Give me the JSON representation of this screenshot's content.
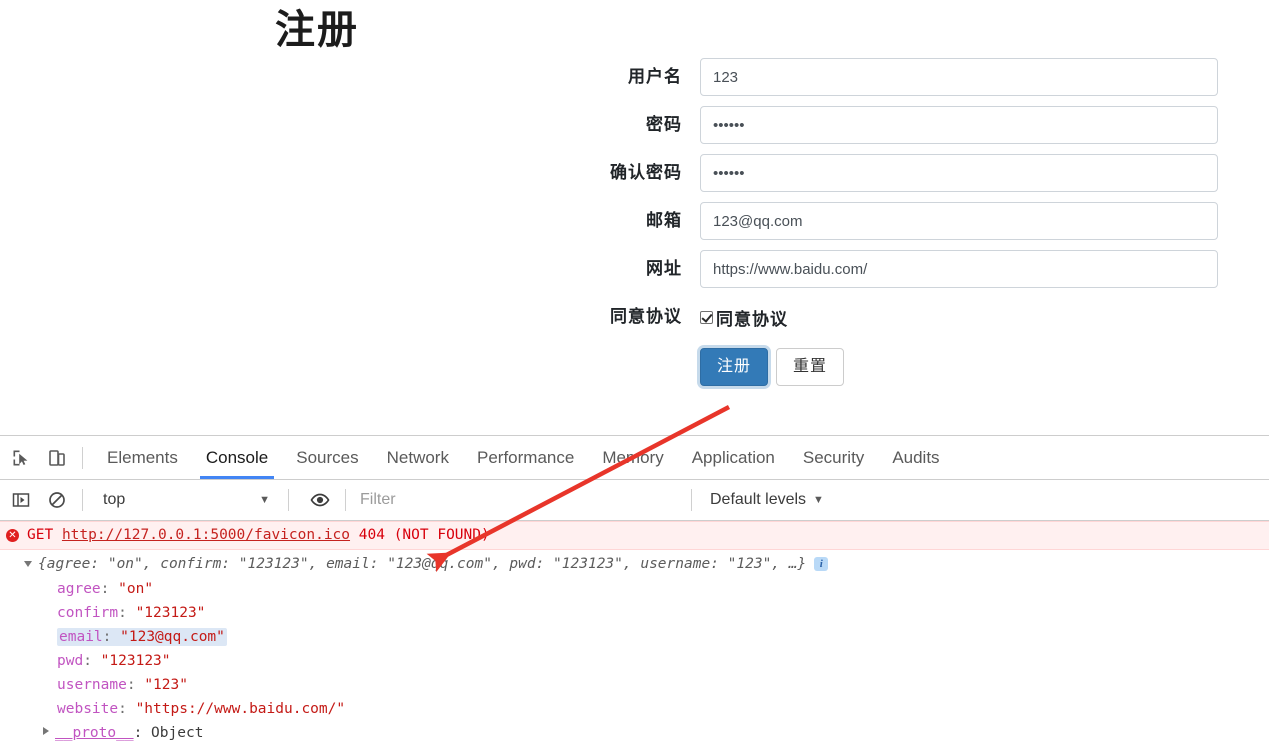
{
  "page": {
    "title": "注册",
    "form": {
      "fields": [
        {
          "label": "用户名",
          "value": "123",
          "type": "text",
          "name": "username"
        },
        {
          "label": "密码",
          "value": "123123",
          "type": "password",
          "name": "pwd"
        },
        {
          "label": "确认密码",
          "value": "123123",
          "type": "password",
          "name": "confirm"
        },
        {
          "label": "邮箱",
          "value": "123@qq.com",
          "type": "email",
          "name": "email"
        },
        {
          "label": "网址",
          "value": "https://www.baidu.com/",
          "type": "url",
          "name": "website"
        }
      ],
      "agree": {
        "label": "同意协议",
        "checkbox_label": "同意协议",
        "checked": true
      },
      "buttons": {
        "submit": "注册",
        "reset": "重置"
      }
    }
  },
  "devtools": {
    "toolbar_icons": [
      {
        "name": "inspect-element-icon"
      },
      {
        "name": "device-toolbar-icon"
      }
    ],
    "tabs": [
      {
        "label": "Elements",
        "active": false
      },
      {
        "label": "Console",
        "active": true
      },
      {
        "label": "Sources",
        "active": false
      },
      {
        "label": "Network",
        "active": false
      },
      {
        "label": "Performance",
        "active": false
      },
      {
        "label": "Memory",
        "active": false
      },
      {
        "label": "Application",
        "active": false
      },
      {
        "label": "Security",
        "active": false
      },
      {
        "label": "Audits",
        "active": false
      }
    ],
    "filterbar": {
      "context": "top",
      "filter_placeholder": "Filter",
      "filter_value": "",
      "levels": "Default levels"
    },
    "console": {
      "error_row": {
        "method": "GET",
        "url": "http://127.0.0.1:5000/favicon.ico",
        "status": "404",
        "status_text": "(NOT FOUND)"
      },
      "object_summary": "{agree: \"on\", confirm: \"123123\", email: \"123@qq.com\", pwd: \"123123\", username: \"123\", …}",
      "object_properties": [
        {
          "key": "agree",
          "value": "\"on\"",
          "highlighted": false
        },
        {
          "key": "confirm",
          "value": "\"123123\"",
          "highlighted": false
        },
        {
          "key": "email",
          "value": "\"123@qq.com\"",
          "highlighted": true
        },
        {
          "key": "pwd",
          "value": "\"123123\"",
          "highlighted": false
        },
        {
          "key": "username",
          "value": "\"123\"",
          "highlighted": false
        },
        {
          "key": "website",
          "value": "\"https://www.baidu.com/\"",
          "highlighted": false
        }
      ],
      "proto_key": "__proto__",
      "proto_value": "Object"
    }
  },
  "annotation": {
    "arrow_color": "#e8352a"
  }
}
